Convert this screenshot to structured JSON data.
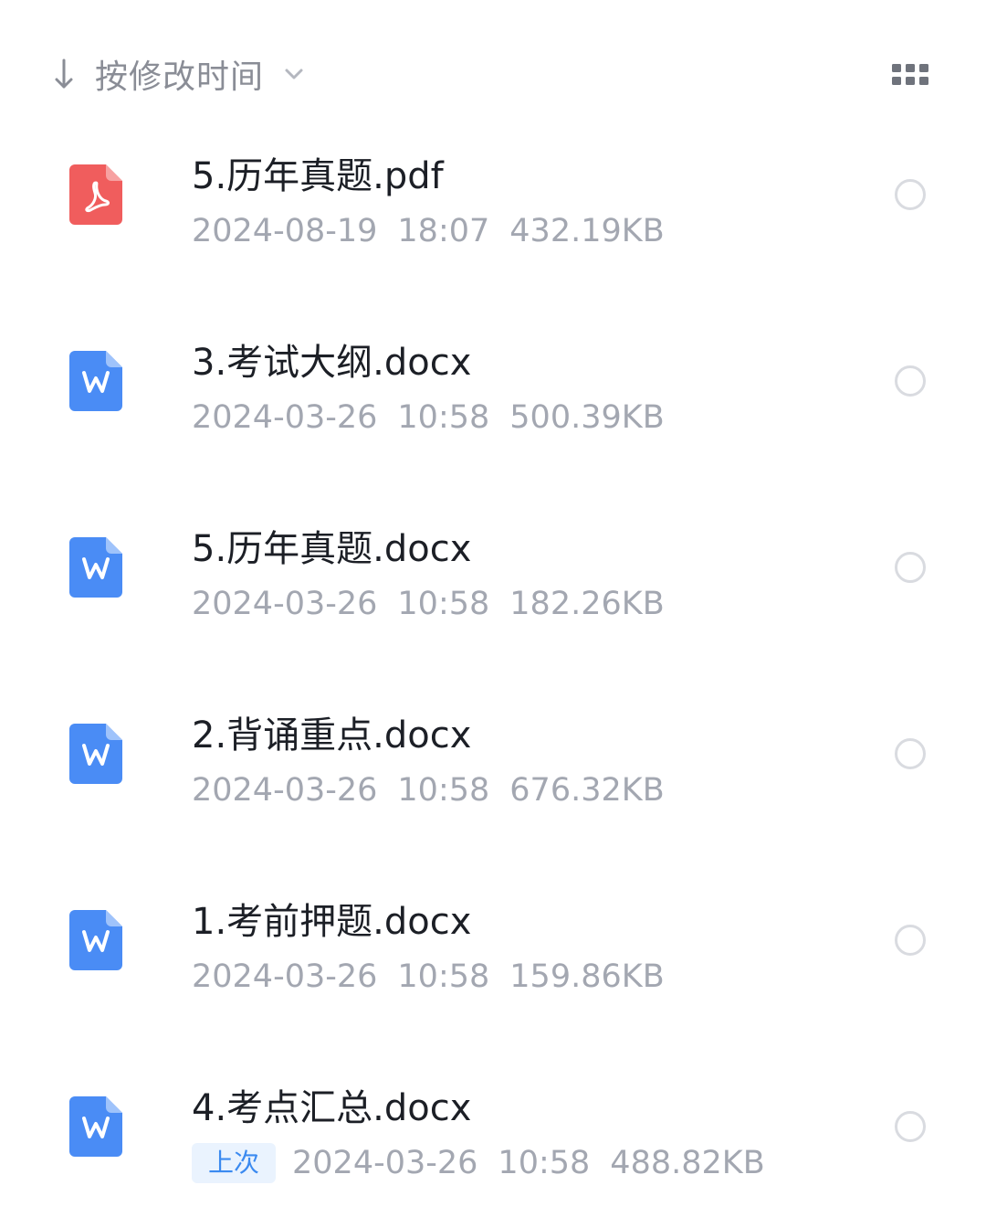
{
  "sort": {
    "label": "按修改时间",
    "direction_icon": "arrow-down-icon",
    "dropdown_icon": "chevron-down-icon",
    "view_toggle_icon": "grid-view-icon"
  },
  "colors": {
    "pdf": "#f05d5d",
    "word": "#4a8cf5",
    "badge_bg": "#eaf3fe",
    "badge_text": "#3b8af0"
  },
  "files": [
    {
      "name": "5.历年真题.pdf",
      "type": "pdf",
      "date": "2024-08-19",
      "time": "18:07",
      "size": "432.19KB",
      "badge": ""
    },
    {
      "name": "3.考试大纲.docx",
      "type": "word",
      "date": "2024-03-26",
      "time": "10:58",
      "size": "500.39KB",
      "badge": ""
    },
    {
      "name": "5.历年真题.docx",
      "type": "word",
      "date": "2024-03-26",
      "time": "10:58",
      "size": "182.26KB",
      "badge": ""
    },
    {
      "name": "2.背诵重点.docx",
      "type": "word",
      "date": "2024-03-26",
      "time": "10:58",
      "size": "676.32KB",
      "badge": ""
    },
    {
      "name": "1.考前押题.docx",
      "type": "word",
      "date": "2024-03-26",
      "time": "10:58",
      "size": "159.86KB",
      "badge": ""
    },
    {
      "name": "4.考点汇总.docx",
      "type": "word",
      "date": "2024-03-26",
      "time": "10:58",
      "size": "488.82KB",
      "badge": "上次"
    }
  ]
}
